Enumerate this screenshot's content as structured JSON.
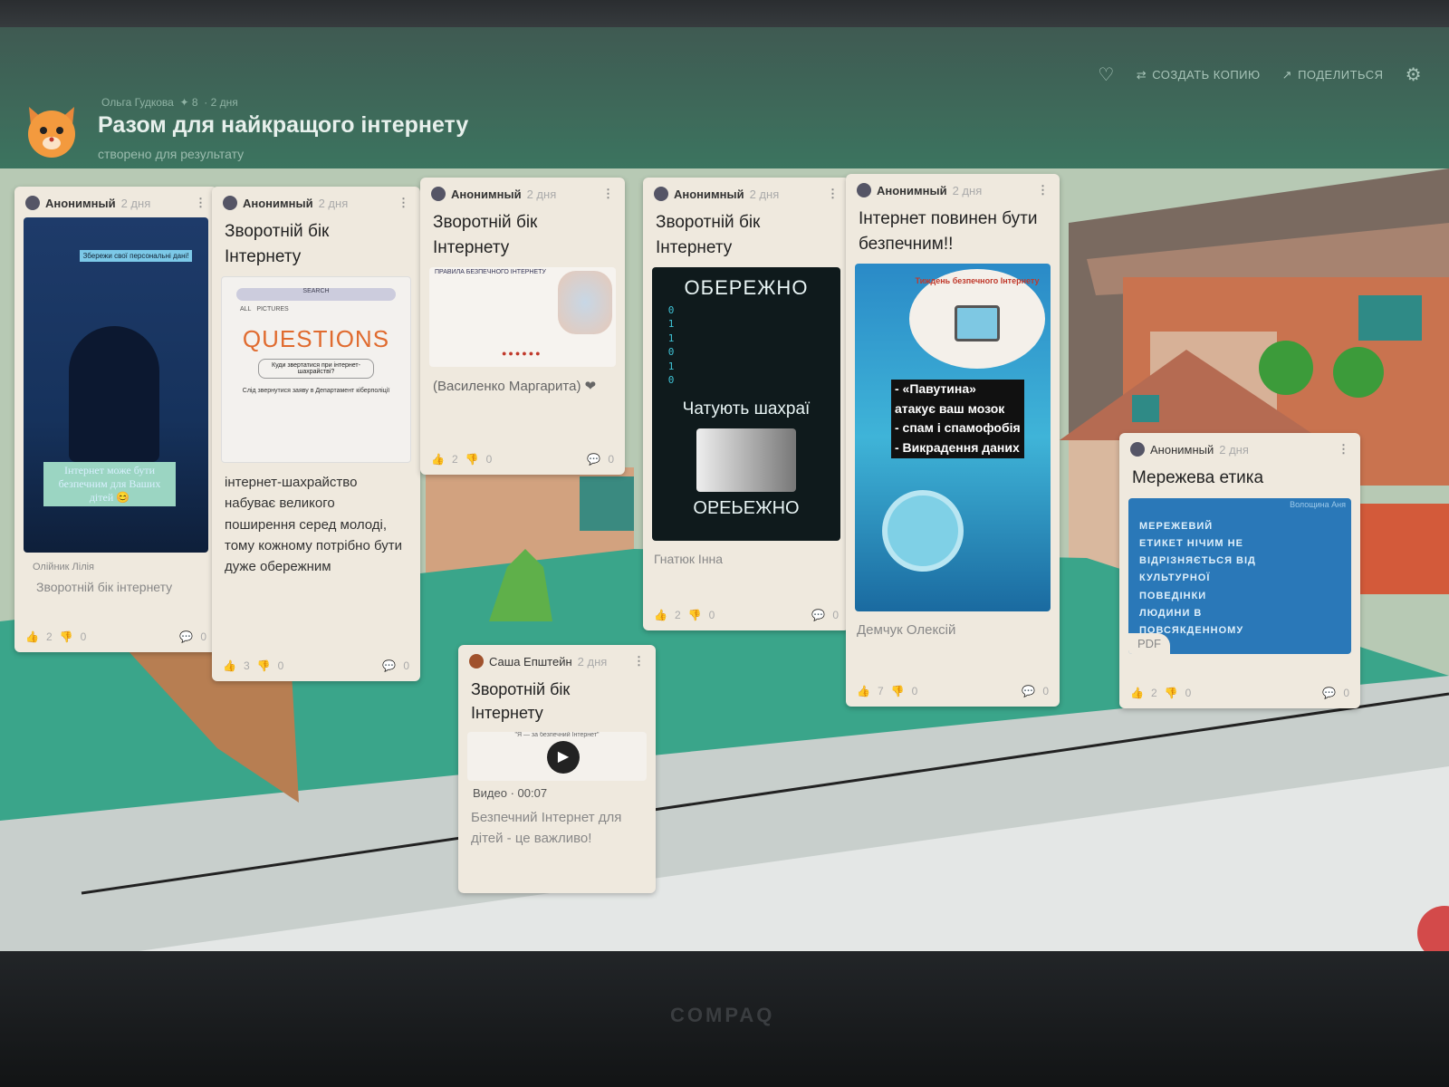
{
  "header": {
    "author": "Ольга Гудкова",
    "likes": "8",
    "time": "2 дня",
    "title": "Разом для найкращого інтернету",
    "subtitle": "створено для результату",
    "actions": {
      "copy": "СОЗДАТЬ КОПИЮ",
      "share": "ПОДЕЛИТЬСЯ"
    }
  },
  "cards": [
    {
      "author": "Анонимный",
      "time": "2 дня",
      "banner": "Збережи свої персональні дані!",
      "img_text": "Інтернет може бути безпечним для Ваших дітей 😊",
      "credit": "Олійник Лілія",
      "caption": "Зворотній бік інтернету",
      "likes": "2",
      "dislikes": "0",
      "comments": "0"
    },
    {
      "author": "Анонимный",
      "time": "2 дня",
      "title": "Зворотній бік Інтернету",
      "img_search": "SEARCH",
      "img_all": "ALL",
      "img_pictures": "PICTURES",
      "img_word": "QUESTIONS",
      "img_box": "Куди звертатися при інтернет-шахрайстві?",
      "img_line": "Слід звернутися заяву в Департамент кіберполіції",
      "text": "інтернет-шахрайство набуває великого поширення серед молоді, тому кожному потрібно бути дуже обережним",
      "likes": "3",
      "dislikes": "0",
      "comments": "0"
    },
    {
      "author": "Анонимный",
      "time": "2 дня",
      "title": "Зворотній бік Інтернету",
      "img_header": "ПРАВИЛА БЕЗПЕЧНОГО ІНТЕРНЕТУ",
      "text": "(Василенко Маргарита) ❤",
      "likes": "2",
      "dislikes": "0",
      "comments": "0"
    },
    {
      "author": "Анонимный",
      "time": "2 дня",
      "title": "Зворотній бік Інтернету",
      "img_top": "ОБЕРЕЖНО",
      "img_mid": "Чатують шахраї",
      "img_bottom": "ОБЕРЕЖНО",
      "caption": "Гнатюк Інна",
      "likes": "2",
      "dislikes": "0",
      "comments": "0"
    },
    {
      "author": "Анонимный",
      "time": "2 дня",
      "title": "Інтернет повинен бути безпечним!!",
      "img_arc": "Тиждень безпечного Інтернету",
      "img_l1": "- «Павутина»",
      "img_l2": "атакує ваш мозок",
      "img_l3": "- спам і спамофобія",
      "img_l4": "- Викрадення даних",
      "caption": "Демчук Олексій",
      "likes": "7",
      "dislikes": "0",
      "comments": "0"
    },
    {
      "author": "Саша Епштейн",
      "time": "2 дня",
      "title": "Зворотній бік Інтернету",
      "img_header": "\"Я — за безпечний Інтернет\"",
      "media": "Видео",
      "duration": "00:07",
      "text": "Безпечний Інтернет для дітей - це важливо!"
    },
    {
      "author": "Анонимный",
      "time": "2 дня",
      "title": "Мережева етика",
      "img_credit": "Волощина Аня",
      "img_text": "МЕРЕЖЕВИЙ ЕТИКЕТ НІЧИМ НЕ ВІДРІЗНЯЄТЬСЯ ВІД КУЛЬТУРНОЇ ПОВЕДІНКИ ЛЮДИНИ В ПОВСЯКДЕННОМУ",
      "file": "PDF",
      "likes": "2",
      "dislikes": "0",
      "comments": "0"
    }
  ],
  "colors": {
    "header": "#3e6a5a",
    "card": "#efe9de",
    "grass": "#3aa58a",
    "like": "#4a6fd0"
  },
  "brand": "COMPAQ"
}
